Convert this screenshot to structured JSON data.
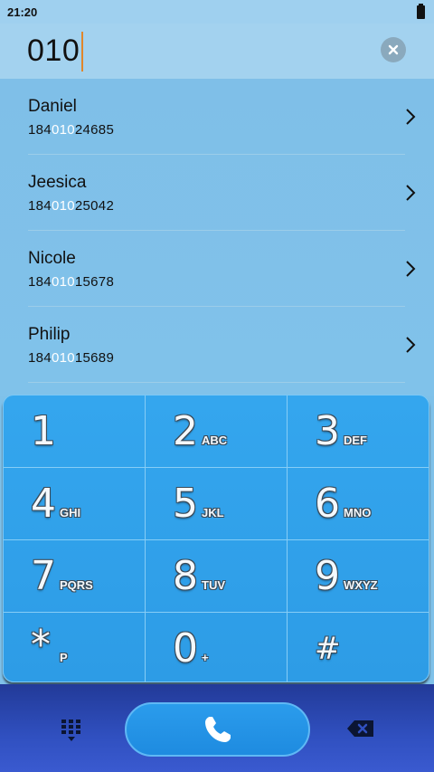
{
  "status_bar": {
    "time": "21:20"
  },
  "dialer": {
    "input_value": "010"
  },
  "contacts": [
    {
      "name": "Daniel",
      "number_prefix": "184",
      "number_match": "010",
      "number_suffix": "24685"
    },
    {
      "name": "Jeesica",
      "number_prefix": "184",
      "number_match": "010",
      "number_suffix": "25042"
    },
    {
      "name": "Nicole",
      "number_prefix": "184",
      "number_match": "010",
      "number_suffix": "15678"
    },
    {
      "name": "Philip",
      "number_prefix": "184",
      "number_match": "010",
      "number_suffix": "15689"
    }
  ],
  "keypad": [
    {
      "digit": "1",
      "letters": ""
    },
    {
      "digit": "2",
      "letters": "ABC"
    },
    {
      "digit": "3",
      "letters": "DEF"
    },
    {
      "digit": "4",
      "letters": "GHI"
    },
    {
      "digit": "5",
      "letters": "JKL"
    },
    {
      "digit": "6",
      "letters": "MNO"
    },
    {
      "digit": "7",
      "letters": "PQRS"
    },
    {
      "digit": "8",
      "letters": "TUV"
    },
    {
      "digit": "9",
      "letters": "WXYZ"
    },
    {
      "digit": "*",
      "letters": "P"
    },
    {
      "digit": "0",
      "letters": "+"
    },
    {
      "digit": "#",
      "letters": ""
    }
  ],
  "icons": {
    "clear": "clear-input-icon",
    "chevron": "chevron-right-icon",
    "dialpad": "dialpad-icon",
    "call": "phone-icon",
    "backspace": "backspace-icon",
    "battery": "battery-icon"
  },
  "colors": {
    "keypad": "#2d9ce6",
    "call_button": "#1e8be0",
    "match_highlight": "#ffffff",
    "bottom_bar": "#223a98"
  }
}
